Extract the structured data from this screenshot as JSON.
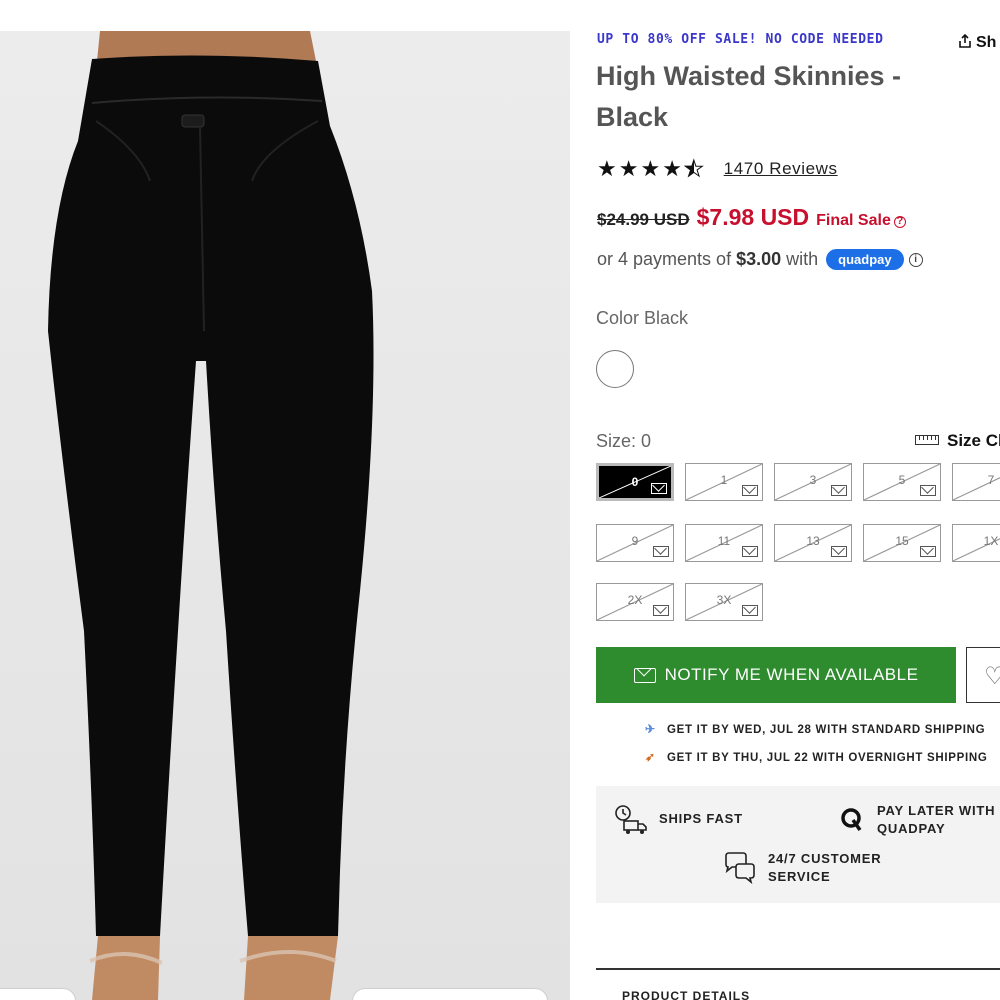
{
  "promo": "UP TO 80% OFF SALE! NO CODE NEEDED",
  "share_label": "Sh",
  "product": {
    "title": "High Waisted Skinnies - Black",
    "rating": 4.5,
    "reviews_label": "1470 Reviews",
    "old_price": "$24.99 USD",
    "price": "$7.98 USD",
    "sale_note": "Final Sale"
  },
  "installments": {
    "prefix": "or 4 payments of",
    "amount": "$3.00",
    "suffix": "with",
    "provider": "quadpay"
  },
  "color": {
    "label": "Color Black",
    "swatch": "#ffffff"
  },
  "size": {
    "label": "Size: 0",
    "chart_label": "Size Cl",
    "selected": "0",
    "options": [
      "0",
      "1",
      "3",
      "5",
      "7",
      "9",
      "11",
      "13",
      "15",
      "1X",
      "2X",
      "3X"
    ]
  },
  "notify_button": "NOTIFY ME WHEN AVAILABLE",
  "shipping": [
    "GET IT BY WED, JUL 28 WITH STANDARD SHIPPING",
    "GET IT BY THU, JUL 22 WITH OVERNIGHT SHIPPING"
  ],
  "perks": {
    "ships_fast": "SHIPS FAST",
    "pay_later": [
      "PAY LATER WITH",
      "QUADPAY"
    ],
    "service": [
      "24/7 CUSTOMER",
      "SERVICE"
    ]
  },
  "product_details": "PRODUCT DETAILS",
  "colors": {
    "accent": "#2e8b2e",
    "sale": "#c8102e",
    "promo": "#3a37c9",
    "quadpay": "#1c6fe6"
  }
}
